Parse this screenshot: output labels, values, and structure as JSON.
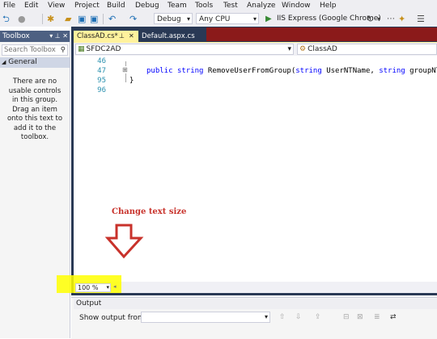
{
  "menu": [
    "File",
    "Edit",
    "View",
    "Project",
    "Build",
    "Debug",
    "Team",
    "Tools",
    "Test",
    "Analyze",
    "Window",
    "Help"
  ],
  "toolbar": {
    "config": "Debug",
    "platform": "Any CPU",
    "run_target": "IIS Express (Google Chrome)"
  },
  "toolbox": {
    "title": "Toolbox",
    "pin_glyphs": "▾ ⊥ ✕",
    "search_placeholder": "Search Toolbox",
    "group": "General",
    "empty_message": "There are no usable controls in this group. Drag an item onto this text to add it to the toolbox."
  },
  "tabs": {
    "active": {
      "label": "ClassAD.cs*",
      "pin": "⊥",
      "close": "✕"
    },
    "inactive": {
      "label": "Default.aspx.cs"
    }
  },
  "nav": {
    "project": "SFDC2AD",
    "class": "ClassAD"
  },
  "editor": {
    "line_numbers": [
      "46",
      "47",
      "95",
      "96"
    ],
    "collapse_glyph": "⊞",
    "code_kw1": "public",
    "code_kw2": "string",
    "code_name": "RemoveUserFromGroup(",
    "code_kw3": "string",
    "code_p1": "UserNTName,",
    "code_kw4": "string",
    "code_p2": "groupNTNa",
    "brace": "}"
  },
  "annotation": {
    "text": "Change text size",
    "arrow": "down-arrow-outline",
    "color": "#c8322b"
  },
  "zoom": {
    "value": "100 %"
  },
  "output": {
    "title": "Output",
    "show_from_label": "Show output from:"
  },
  "colors": {
    "accent": "#293955",
    "highlight": "#ffff00",
    "tab_active": "#fff29d",
    "banner": "#8b1a1a"
  }
}
